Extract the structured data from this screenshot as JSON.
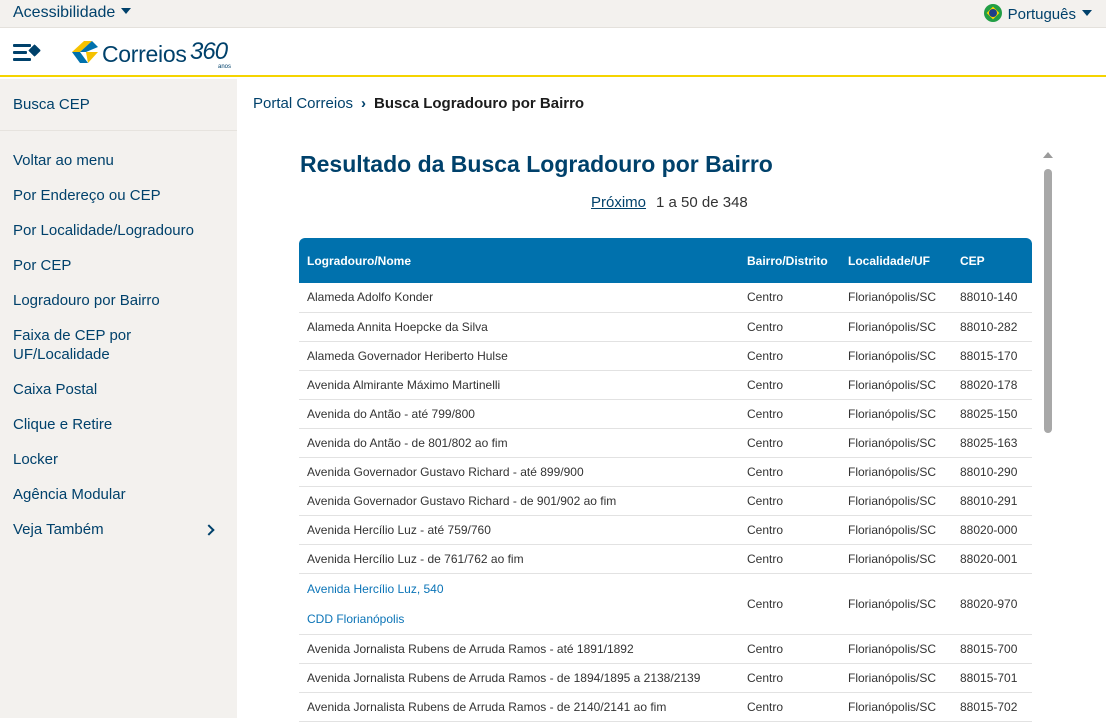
{
  "topbar": {
    "accessibility": "Acessibilidade",
    "language": "Português"
  },
  "header": {
    "logo_text": "Correios",
    "logo_360": "360",
    "logo_sub": "anos"
  },
  "sidebar": {
    "title": "Busca CEP",
    "items": [
      {
        "label": "Voltar ao menu"
      },
      {
        "label": "Por Endereço ou CEP"
      },
      {
        "label": "Por Localidade/Logradouro"
      },
      {
        "label": "Por CEP"
      },
      {
        "label": "Logradouro por Bairro"
      },
      {
        "label": "Faixa de CEP por UF/Localidade"
      },
      {
        "label": "Caixa Postal"
      },
      {
        "label": "Clique e Retire"
      },
      {
        "label": "Locker"
      },
      {
        "label": "Agência Modular"
      },
      {
        "label": "Veja Também"
      }
    ]
  },
  "breadcrumb": {
    "home": "Portal Correios",
    "separator": "›",
    "current": "Busca Logradouro por Bairro"
  },
  "results": {
    "title": "Resultado da Busca Logradouro por Bairro",
    "next_label": "Próximo",
    "range": "1 a 50 de 348",
    "columns": [
      "Logradouro/Nome",
      "Bairro/Distrito",
      "Localidade/UF",
      "CEP"
    ],
    "rows": [
      {
        "logradouro": "Alameda Adolfo Konder",
        "bairro": "Centro",
        "localidade": "Florianópolis/SC",
        "cep": "88010-140"
      },
      {
        "logradouro": "Alameda Annita Hoepcke da Silva",
        "bairro": "Centro",
        "localidade": "Florianópolis/SC",
        "cep": "88010-282"
      },
      {
        "logradouro": "Alameda Governador Heriberto Hulse",
        "bairro": "Centro",
        "localidade": "Florianópolis/SC",
        "cep": "88015-170"
      },
      {
        "logradouro": "Avenida Almirante Máximo Martinelli",
        "bairro": "Centro",
        "localidade": "Florianópolis/SC",
        "cep": "88020-178"
      },
      {
        "logradouro": "Avenida do Antão - até 799/800",
        "bairro": "Centro",
        "localidade": "Florianópolis/SC",
        "cep": "88025-150"
      },
      {
        "logradouro": "Avenida do Antão - de 801/802 ao fim",
        "bairro": "Centro",
        "localidade": "Florianópolis/SC",
        "cep": "88025-163"
      },
      {
        "logradouro": "Avenida Governador Gustavo Richard - até 899/900",
        "bairro": "Centro",
        "localidade": "Florianópolis/SC",
        "cep": "88010-290"
      },
      {
        "logradouro": "Avenida Governador Gustavo Richard - de 901/902 ao fim",
        "bairro": "Centro",
        "localidade": "Florianópolis/SC",
        "cep": "88010-291"
      },
      {
        "logradouro": "Avenida Hercílio Luz - até 759/760",
        "bairro": "Centro",
        "localidade": "Florianópolis/SC",
        "cep": "88020-000"
      },
      {
        "logradouro": "Avenida Hercílio Luz - de 761/762 ao fim",
        "bairro": "Centro",
        "localidade": "Florianópolis/SC",
        "cep": "88020-001"
      },
      {
        "logradouro": "Avenida Hercílio Luz, 540",
        "logradouro2": "CDD Florianópolis",
        "bairro": "Centro",
        "localidade": "Florianópolis/SC",
        "cep": "88020-970"
      },
      {
        "logradouro": "Avenida Jornalista Rubens de Arruda Ramos - até 1891/1892",
        "bairro": "Centro",
        "localidade": "Florianópolis/SC",
        "cep": "88015-700"
      },
      {
        "logradouro": "Avenida Jornalista Rubens de Arruda Ramos - de 1894/1895 a 2138/2139",
        "bairro": "Centro",
        "localidade": "Florianópolis/SC",
        "cep": "88015-701"
      },
      {
        "logradouro": "Avenida Jornalista Rubens de Arruda Ramos - de 2140/2141 ao fim",
        "bairro": "Centro",
        "localidade": "Florianópolis/SC",
        "cep": "88015-702"
      }
    ]
  },
  "colors": {
    "brand_blue": "#00416b",
    "table_header": "#0071ad",
    "accent_yellow": "#f5d400",
    "sidebar_bg": "#f3f1ee",
    "link_blue": "#0b74b7"
  }
}
